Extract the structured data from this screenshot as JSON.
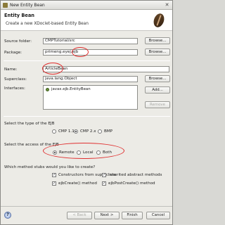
{
  "window": {
    "title": "New Entity Bean"
  },
  "header": {
    "title": "Entity Bean",
    "description": "Create a new XDoclet-based Entity Bean",
    "icon": "coffee-bean-icon"
  },
  "form": {
    "source_folder": {
      "label": "Source folder:",
      "value": "CMPTutorial/src",
      "browse": "Browse..."
    },
    "package": {
      "label": "Package:",
      "value": "primeng.eyej.ejb",
      "browse": "Browse..."
    },
    "name": {
      "label": "Name:",
      "value": "ArticleBean"
    },
    "superclass": {
      "label": "Superclass:",
      "value": "java.lang.Object",
      "browse": "Browse..."
    },
    "interfaces": {
      "label": "Interfaces:",
      "items": [
        "javax.ejb.EntityBean"
      ],
      "add": "Add...",
      "remove": "Remove"
    }
  },
  "ejb_type": {
    "label": "Select the type of the EJB",
    "options": [
      "CMP 1.1",
      "CMP 2.x",
      "BMP"
    ],
    "selected": "CMP 2.x"
  },
  "ejb_access": {
    "label": "Select the access of the EJB",
    "options": [
      "Remote",
      "Local",
      "Both"
    ],
    "selected": "Remote"
  },
  "method_stubs": {
    "label": "Which method stubs would you like to create?",
    "items": [
      {
        "label": "Constructors from superclass",
        "checked": true
      },
      {
        "label": "Inherited abstract methods",
        "checked": true
      },
      {
        "label": "ejbCreate() method",
        "checked": true
      },
      {
        "label": "ejbPostCreate() method",
        "checked": true
      }
    ]
  },
  "footer": {
    "back": "< Back",
    "next": "Next >",
    "finish": "Finish",
    "cancel": "Cancel",
    "help_icon": "help-icon"
  },
  "colors": {
    "annotation": "#e03030",
    "header_bg": "#ffffff",
    "dialog_bg": "#ecebe6"
  }
}
